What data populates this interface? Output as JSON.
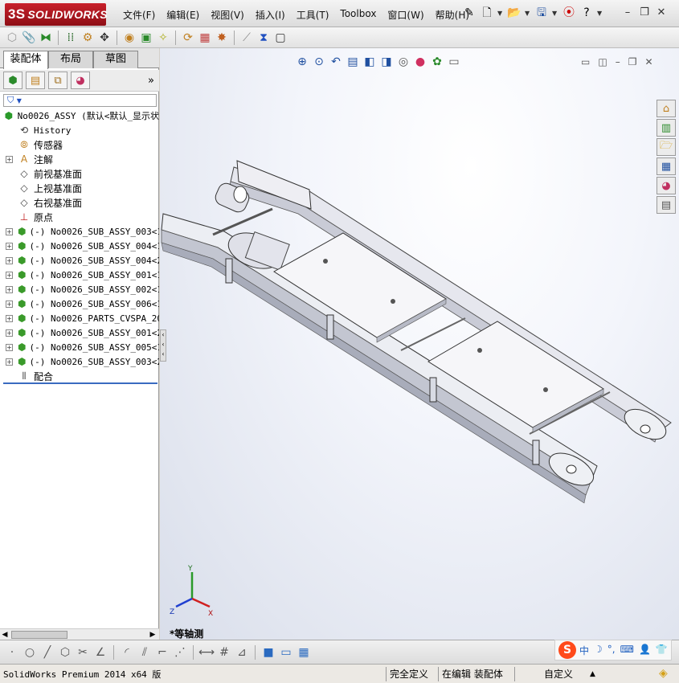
{
  "app": {
    "logo": {
      "mark": "3S",
      "text": "SOLIDWORKS"
    },
    "menus": [
      "文件(F)",
      "编辑(E)",
      "视图(V)",
      "插入(I)",
      "工具(T)",
      "Toolbox",
      "窗口(W)",
      "帮助(H)"
    ],
    "title_tools": [
      "pin-icon",
      "new-document-icon",
      "open-folder-icon",
      "save-icon",
      "traffic-light-icon",
      "help-icon"
    ],
    "window_buttons": [
      "minimize",
      "restore",
      "close"
    ]
  },
  "command_toolbar": {
    "icons": [
      "component-icon",
      "paperclip-icon",
      "mate-icon",
      "linear-pattern-icon",
      "smart-fastener-icon",
      "move-component-icon",
      "hide-show-icon",
      "assembly-features-icon",
      "reference-geometry-icon",
      "new-motion-study-icon",
      "bill-of-materials-icon",
      "exploded-view-icon",
      "explode-line-icon",
      "interference-icon",
      "instant3d-icon"
    ]
  },
  "left_pane": {
    "tabs": [
      "装配体",
      "布局",
      "草图"
    ],
    "active_tab": 0,
    "manager_icons": [
      "feature-manager-icon",
      "property-manager-icon",
      "configuration-manager-icon",
      "display-manager-icon"
    ],
    "more": "»",
    "filter_symbol": "▼",
    "tree": [
      {
        "label": "No0026_ASSY  (默认<默认_显示状",
        "icon": "assembly-icon",
        "expandable": false,
        "indent": 0
      },
      {
        "label": "History",
        "icon": "history-icon",
        "expandable": false,
        "indent": 1
      },
      {
        "label": "传感器",
        "icon": "sensor-icon",
        "expandable": false,
        "indent": 1
      },
      {
        "label": "注解",
        "icon": "annotation-icon",
        "expandable": true,
        "indent": 1
      },
      {
        "label": "前视基准面",
        "icon": "plane-icon",
        "expandable": false,
        "indent": 1
      },
      {
        "label": "上视基准面",
        "icon": "plane-icon",
        "expandable": false,
        "indent": 1
      },
      {
        "label": "右视基准面",
        "icon": "plane-icon",
        "expandable": false,
        "indent": 1
      },
      {
        "label": "原点",
        "icon": "origin-icon",
        "expandable": false,
        "indent": 1
      },
      {
        "label": "(-) No0026_SUB_ASSY_003<1",
        "icon": "subassembly-icon",
        "expandable": true,
        "indent": 1
      },
      {
        "label": "(-) No0026_SUB_ASSY_004<1",
        "icon": "subassembly-icon",
        "expandable": true,
        "indent": 1
      },
      {
        "label": "(-) No0026_SUB_ASSY_004<2",
        "icon": "subassembly-icon",
        "expandable": true,
        "indent": 1
      },
      {
        "label": "(-) No0026_SUB_ASSY_001<1",
        "icon": "subassembly-icon",
        "expandable": true,
        "indent": 1
      },
      {
        "label": "(-) No0026_SUB_ASSY_002<1",
        "icon": "subassembly-icon",
        "expandable": true,
        "indent": 1
      },
      {
        "label": "(-) No0026_SUB_ASSY_006<1",
        "icon": "subassembly-icon",
        "expandable": true,
        "indent": 1
      },
      {
        "label": "(-) No0026_PARTS_CVSPA_200",
        "icon": "subassembly-icon",
        "expandable": true,
        "indent": 1
      },
      {
        "label": "(-) No0026_SUB_ASSY_001<2",
        "icon": "subassembly-icon",
        "expandable": true,
        "indent": 1
      },
      {
        "label": "(-) No0026_SUB_ASSY_005<1",
        "icon": "subassembly-icon",
        "expandable": true,
        "indent": 1
      },
      {
        "label": "(-) No0026_SUB_ASSY_003<2",
        "icon": "subassembly-icon",
        "expandable": true,
        "indent": 1
      },
      {
        "label": "配合",
        "icon": "mates-icon",
        "expandable": false,
        "indent": 1
      }
    ]
  },
  "viewport": {
    "heads_up_icons": [
      "zoom-to-fit-icon",
      "zoom-to-area-icon",
      "previous-view-icon",
      "section-view-icon",
      "view-orientation-icon",
      "display-style-icon",
      "hide-show-items-icon",
      "edit-appearance-icon",
      "apply-scene-icon",
      "view-settings-icon"
    ],
    "window_controls": [
      "split-horizontal",
      "split-vertical",
      "minimize",
      "restore",
      "close"
    ],
    "task_pane_icons": [
      "solidworks-resources-icon",
      "design-library-icon",
      "file-explorer-icon",
      "view-palette-icon",
      "appearances-icon",
      "custom-properties-icon"
    ],
    "view_name": "*等轴测",
    "triad": {
      "x": "X",
      "y": "Y",
      "z": "Z"
    }
  },
  "sketch_toolbar": {
    "icons": [
      "point-icon",
      "circle-icon",
      "line-icon",
      "polygon-icon",
      "trim-icon",
      "angle-icon",
      "sketch-fillet-icon",
      "offset-icon",
      "corner-icon",
      "construction-icon",
      "dimension-icon",
      "grid-icon",
      "relations-icon",
      "shaded-box-icon",
      "view-box-icon",
      "table-icon"
    ]
  },
  "ime": {
    "logo": "S",
    "items": [
      "中",
      "☽",
      "°,",
      "⌨",
      "👤",
      "👕"
    ]
  },
  "status_bar": {
    "product": "SolidWorks Premium 2014 x64 版",
    "definition": "完全定义",
    "editing": "在编辑 装配体",
    "units": "自定义"
  }
}
